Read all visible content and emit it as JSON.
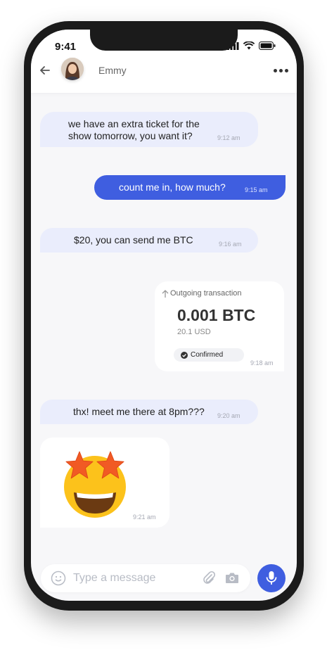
{
  "status": {
    "time": "9:41"
  },
  "header": {
    "contact_name": "Emmy"
  },
  "messages": [
    {
      "from": "contact",
      "text_line1": "we have an extra ticket for the",
      "text_line2": "show tomorrow, you want it?",
      "time": "9:12 am"
    },
    {
      "from": "me",
      "text": "count me in, how much?",
      "time": "9:15 am"
    },
    {
      "from": "contact",
      "text": "$20, you can send me BTC",
      "time": "9:16 am"
    },
    {
      "from": "me",
      "type": "transaction",
      "label": "Outgoing transaction",
      "amount": "0.001 BTC",
      "fiat": "20.1 USD",
      "status": "Confirmed",
      "time": "9:18 am"
    },
    {
      "from": "contact",
      "text": "thx! meet me there at 8pm???",
      "time": "9:20 am"
    },
    {
      "from": "contact",
      "type": "emoji",
      "emoji": "star-struck",
      "time": "9:21 am"
    }
  ],
  "composer": {
    "placeholder": "Type a message"
  },
  "colors": {
    "accent": "#3f5ee0",
    "incoming_bubble": "#eaedfc",
    "background": "#f7f7f9",
    "star": "#f15a24",
    "emoji_face": "#fcc21b"
  }
}
